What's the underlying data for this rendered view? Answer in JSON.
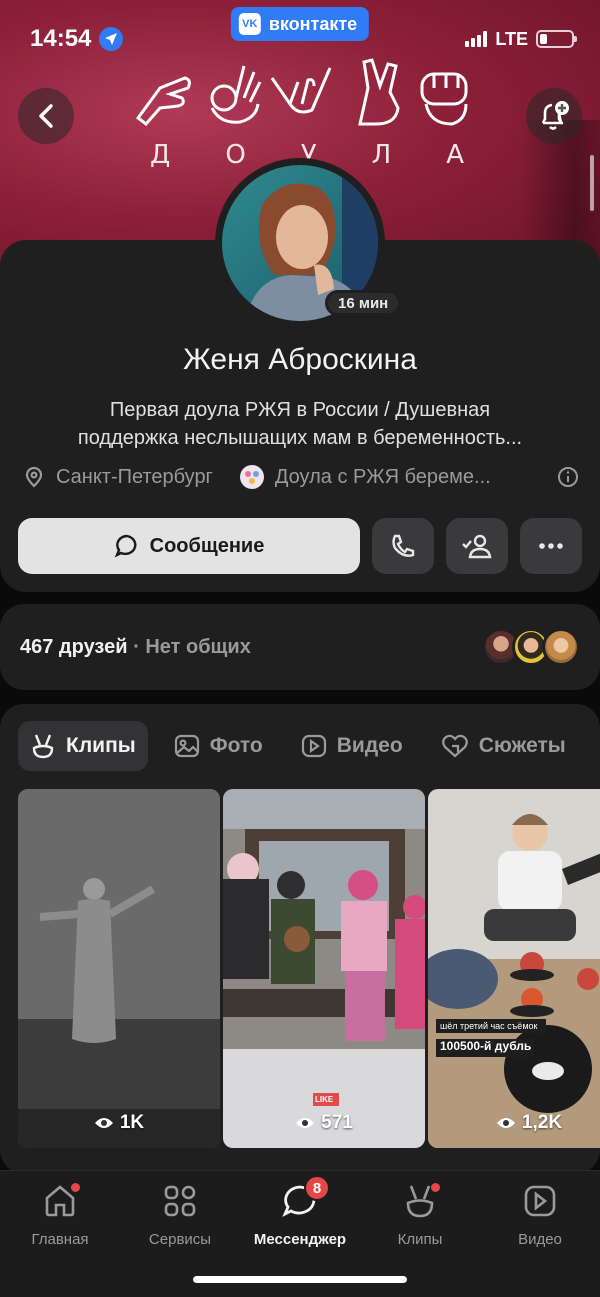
{
  "status_bar": {
    "time": "14:54",
    "network": "LTE",
    "battery_level": 0.22
  },
  "app_banner": {
    "label": "вконтакте",
    "logo_text": "VK"
  },
  "cover": {
    "letters": [
      "Д",
      "О",
      "У",
      "Л",
      "А"
    ]
  },
  "profile": {
    "online_status": "16 мин",
    "name": "Женя Аброскина",
    "bio_line1": "Первая доула РЖЯ в России / Душевная",
    "bio_line2": "поддержка неслышащих мам в беременность...",
    "city": "Санкт-Петербург",
    "group": "Доула с РЖЯ береме...",
    "message_button": "Сообщение"
  },
  "friends": {
    "count": "467 друзей",
    "separator": "·",
    "mutual": "Нет общих"
  },
  "tabs": [
    {
      "label": "Клипы",
      "icon": "clips-icon",
      "active": true
    },
    {
      "label": "Фото",
      "icon": "photo-icon",
      "active": false
    },
    {
      "label": "Видео",
      "icon": "video-icon",
      "active": false
    },
    {
      "label": "Сюжеты",
      "icon": "stories-icon",
      "active": false
    }
  ],
  "clips": [
    {
      "views": "1K"
    },
    {
      "views": "571",
      "overlay_badge": "LIKE"
    },
    {
      "views": "1,2K",
      "caption_line1": "шёл третий час съёмок",
      "caption_line2": "100500-й дубль"
    }
  ],
  "bottom_nav": [
    {
      "label": "Главная",
      "icon": "home-icon",
      "dot": true
    },
    {
      "label": "Сервисы",
      "icon": "services-icon"
    },
    {
      "label": "Мессенджер",
      "icon": "messenger-icon",
      "badge": "8",
      "active": true
    },
    {
      "label": "Клипы",
      "icon": "clips-icon",
      "dot": true
    },
    {
      "label": "Видео",
      "icon": "video-icon"
    }
  ],
  "colors": {
    "accent": "#2f7cf6",
    "cover": "#8c2038",
    "card": "#1f1f1f",
    "notification": "#e64646"
  }
}
